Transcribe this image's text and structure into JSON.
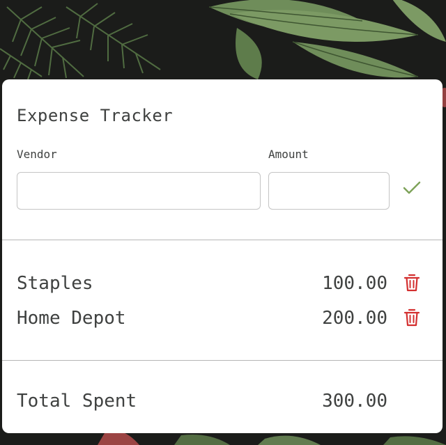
{
  "app": {
    "title": "Expense Tracker"
  },
  "form": {
    "vendor_label": "Vendor",
    "vendor_value": "",
    "amount_label": "Amount",
    "amount_value": "",
    "confirm_icon": "check-icon"
  },
  "expenses": [
    {
      "vendor": "Staples",
      "amount": "100.00",
      "delete_icon": "trash-icon"
    },
    {
      "vendor": "Home Depot",
      "amount": "200.00",
      "delete_icon": "trash-icon"
    }
  ],
  "summary": {
    "label": "Total Spent",
    "value": "300.00"
  },
  "colors": {
    "confirm": "#7ea35a",
    "delete": "#d32f2f",
    "text": "#3f4140",
    "card": "#ffffff",
    "background": "#1b1c1a"
  }
}
